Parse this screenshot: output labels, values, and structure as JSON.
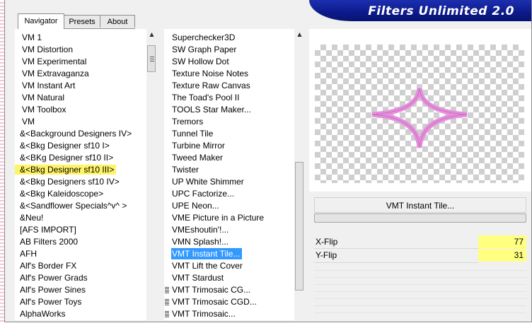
{
  "app": {
    "title": "Filters Unlimited 2.0"
  },
  "tabs": [
    {
      "label": "Navigator",
      "active": true
    },
    {
      "label": "Presets",
      "active": false
    },
    {
      "label": "About",
      "active": false
    }
  ],
  "categories": [
    "VM 1",
    "VM Distortion",
    "VM Experimental",
    "VM Extravaganza",
    "VM Instant Art",
    "VM Natural",
    "VM Toolbox",
    "VM",
    "&<Background Designers IV>",
    "&<Bkg Designer sf10 I>",
    "&<BKg Designer sf10 II>",
    "&<Bkg Designer sf10 III>",
    "&<Bkg Designers sf10 IV>",
    "&<Bkg Kaleidoscope>",
    "&<Sandflower Specials^v^ >",
    "&Neu!",
    "[AFS IMPORT]",
    "AB Filters 2000",
    "AFH",
    "Alf's Border FX",
    "Alf's Power Grads",
    "Alf's Power Sines",
    "Alf's Power Toys",
    "AlphaWorks"
  ],
  "categories_highlighted_index": 11,
  "filters": [
    "Superchecker3D",
    "SW Graph Paper",
    "SW Hollow Dot",
    "Texture Noise Notes",
    "Texture Raw Canvas",
    "The Toad's Pool II",
    "TOOLS Star Maker...",
    "Tremors",
    "Tunnel Tile",
    "Turbine Mirror",
    "Tweed Maker",
    "Twister",
    "UP White Shimmer",
    "UPC Factorize...",
    "UPE Neon...",
    "VME Picture in a Picture",
    "VMEshoutin'!...",
    "VMN Splash!...",
    "VMT Instant Tile...",
    "VMT Lift the Cover",
    "VMT Stardust",
    "VMT Trimosaic CG...",
    "VMT Trimosaic CGD...",
    "VMT Trimosaic..."
  ],
  "filters_selected_index": 18,
  "selected_filter": {
    "label": "VMT Instant Tile..."
  },
  "params": [
    {
      "label": "X-Flip",
      "value": "77"
    },
    {
      "label": "Y-Flip",
      "value": "31"
    }
  ],
  "colors": {
    "highlight_yellow": "#fff468",
    "selection_blue": "#3399ff",
    "banner_blue": "#0c1a8a",
    "shape_pink": "#e58fdc"
  }
}
